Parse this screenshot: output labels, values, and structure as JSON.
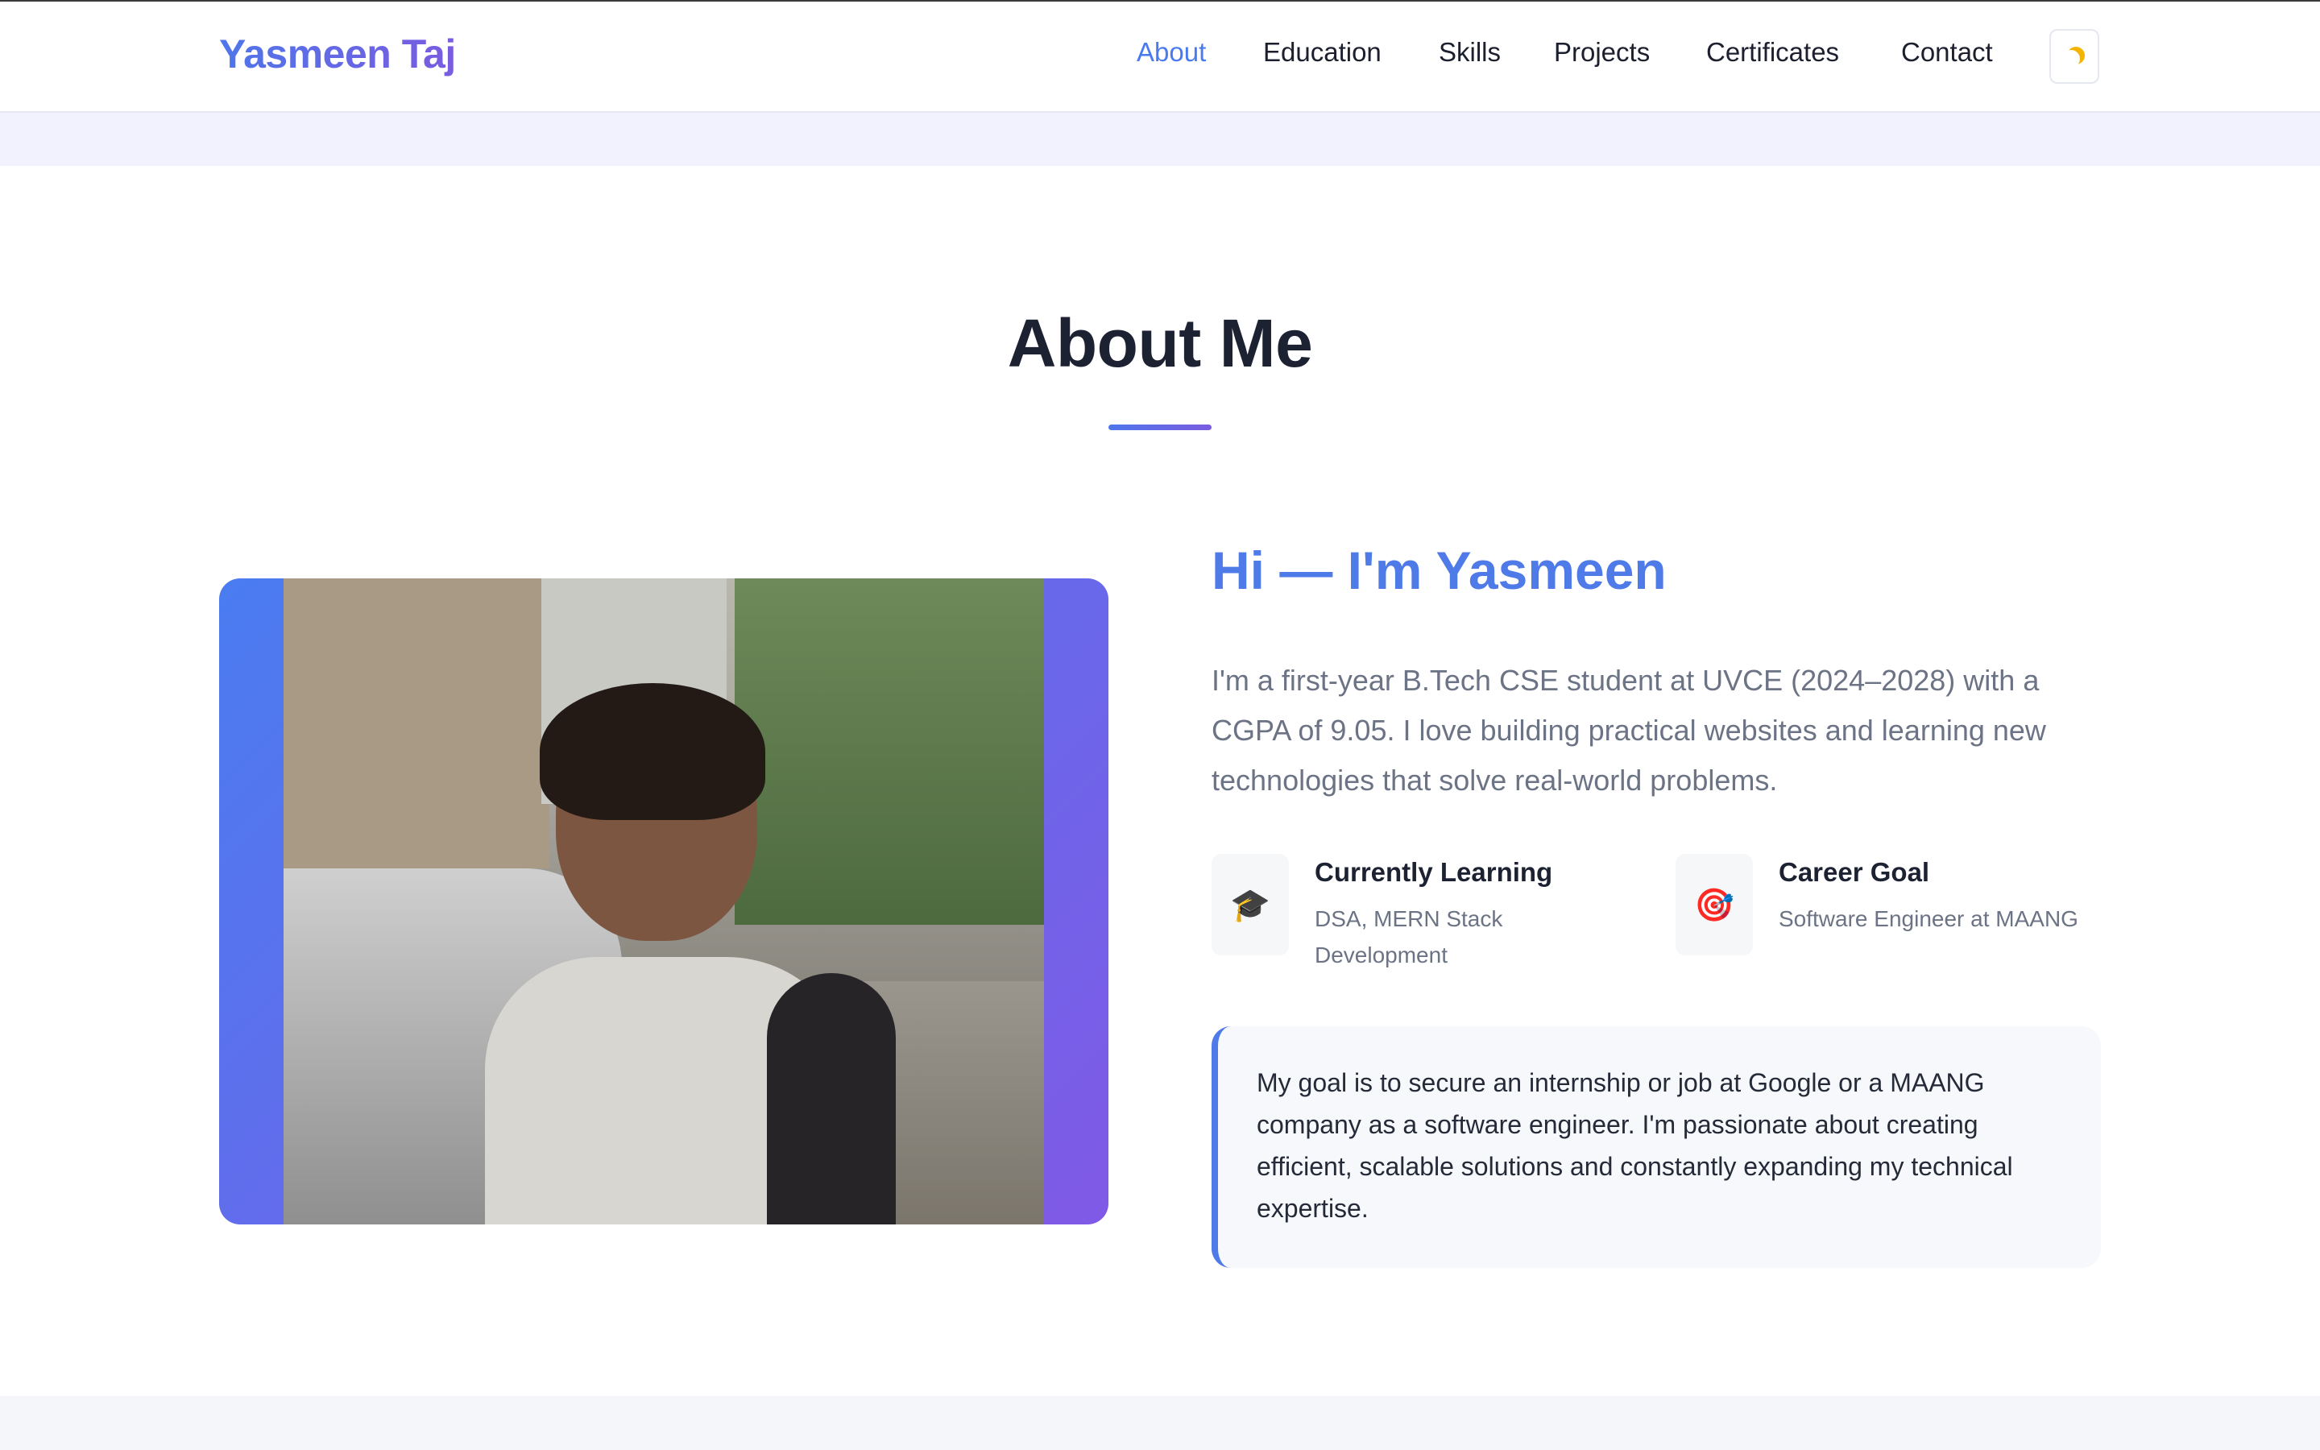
{
  "brand": "Yasmeen Taj",
  "nav": {
    "items": [
      {
        "label": "About",
        "active": true
      },
      {
        "label": "Education",
        "active": false
      },
      {
        "label": "Skills",
        "active": false
      },
      {
        "label": "Projects",
        "active": false
      },
      {
        "label": "Certificates",
        "active": false
      },
      {
        "label": "Contact",
        "active": false
      }
    ],
    "theme_toggle_icon": "moon-icon"
  },
  "about": {
    "section_title": "About Me",
    "greeting": "Hi — I'm Yasmeen",
    "intro": "I'm a first-year B.Tech CSE student at UVCE (2024–2028) with a CGPA of 9.05. I love building practical websites and learning new technologies that solve real-world problems.",
    "cards": [
      {
        "icon": "graduation-cap-icon",
        "glyph": "🎓",
        "title": "Currently Learning",
        "text": "DSA, MERN Stack Development"
      },
      {
        "icon": "target-icon",
        "glyph": "🎯",
        "title": "Career Goal",
        "text": "Software Engineer at MAANG"
      }
    ],
    "goal": "My goal is to secure an internship or job at Google or a MAANG company as a software engineer. I'm passionate about creating efficient, scalable solutions and constantly expanding my technical expertise."
  },
  "colors": {
    "accent": "#4f7be9",
    "accent_purple": "#7a5be0",
    "text_dark": "#1d2233",
    "text_muted": "#6b7385"
  }
}
